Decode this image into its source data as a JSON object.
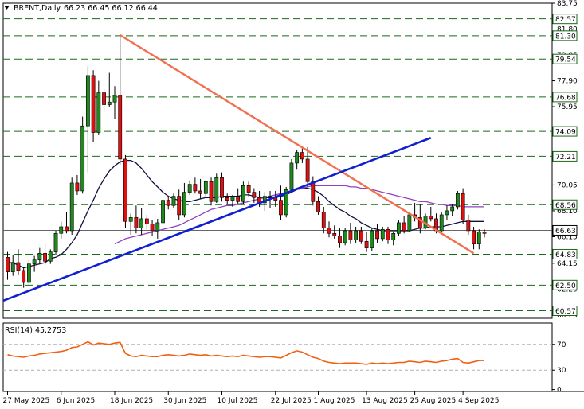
{
  "header": {
    "symbol": "BRENT,Daily",
    "ohlc": "66.23 66.45 66.12 66.44"
  },
  "rsi_header": "RSI(14) 45.2753",
  "colors": {
    "bull": "#1e8a1e",
    "bear": "#e01010",
    "resistance_line": "#f07050",
    "support_line": "#1020d0",
    "ma_fast": "#101040",
    "ma_slow": "#9040c0",
    "rsi_line": "#f06010",
    "level_line": "#1a6a1a",
    "current_price_line": "#505050"
  },
  "chart_data": [
    {
      "type": "candlestick",
      "title": "BRENT,Daily",
      "ylim": [
        60.0,
        83.75
      ],
      "y_ticks": [
        "83.75",
        "81.80",
        "79.85",
        "77.90",
        "75.95",
        "74.00",
        "72.05",
        "70.05",
        "68.10",
        "66.15",
        "64.15",
        "62.20",
        "60.25"
      ],
      "x_tick_labels": [
        "27 May 2025",
        "6 Jun 2025",
        "18 Jun 2025",
        "30 Jun 2025",
        "10 Jul 2025",
        "22 Jul 2025",
        "1 Aug 2025",
        "13 Aug 2025",
        "25 Aug 2025",
        "4 Sep 2025"
      ],
      "x_tick_index": [
        0,
        10,
        20,
        30,
        40,
        50,
        58,
        67,
        76,
        85
      ],
      "level_lines": [
        "82.57",
        "81.30",
        "79.54",
        "76.68",
        "74.09",
        "72.21",
        "68.56",
        "64.83",
        "62.50",
        "60.57"
      ],
      "current_price": "66.63",
      "candles": [
        {
          "o": 64.6,
          "h": 65.0,
          "l": 62.9,
          "c": 63.5
        },
        {
          "o": 63.5,
          "h": 64.8,
          "l": 63.2,
          "c": 64.2
        },
        {
          "o": 64.2,
          "h": 65.2,
          "l": 63.3,
          "c": 63.6
        },
        {
          "o": 63.6,
          "h": 63.9,
          "l": 62.3,
          "c": 62.7
        },
        {
          "o": 62.7,
          "h": 64.4,
          "l": 62.5,
          "c": 64.1
        },
        {
          "o": 64.1,
          "h": 64.7,
          "l": 63.5,
          "c": 64.4
        },
        {
          "o": 64.4,
          "h": 65.3,
          "l": 64.2,
          "c": 64.9
        },
        {
          "o": 64.9,
          "h": 65.6,
          "l": 64.0,
          "c": 64.3
        },
        {
          "o": 64.3,
          "h": 65.2,
          "l": 64.1,
          "c": 65.0
        },
        {
          "o": 65.0,
          "h": 66.6,
          "l": 64.8,
          "c": 66.4
        },
        {
          "o": 66.4,
          "h": 67.3,
          "l": 66.0,
          "c": 66.9
        },
        {
          "o": 66.9,
          "h": 68.0,
          "l": 66.4,
          "c": 66.6
        },
        {
          "o": 66.6,
          "h": 70.6,
          "l": 66.3,
          "c": 70.2
        },
        {
          "o": 70.2,
          "h": 70.8,
          "l": 69.3,
          "c": 69.6
        },
        {
          "o": 69.6,
          "h": 75.2,
          "l": 69.4,
          "c": 74.5
        },
        {
          "o": 74.5,
          "h": 79.0,
          "l": 71.0,
          "c": 78.3
        },
        {
          "o": 78.3,
          "h": 78.7,
          "l": 73.3,
          "c": 74.0
        },
        {
          "o": 74.0,
          "h": 77.9,
          "l": 73.8,
          "c": 77.0
        },
        {
          "o": 77.0,
          "h": 77.3,
          "l": 75.5,
          "c": 76.1
        },
        {
          "o": 76.1,
          "h": 78.5,
          "l": 75.9,
          "c": 76.3
        },
        {
          "o": 76.3,
          "h": 77.5,
          "l": 75.0,
          "c": 76.8
        },
        {
          "o": 76.8,
          "h": 81.4,
          "l": 71.6,
          "c": 72.0
        },
        {
          "o": 72.0,
          "h": 72.3,
          "l": 66.8,
          "c": 67.3
        },
        {
          "o": 67.3,
          "h": 67.9,
          "l": 66.3,
          "c": 67.6
        },
        {
          "o": 67.6,
          "h": 68.5,
          "l": 66.4,
          "c": 66.8
        },
        {
          "o": 66.8,
          "h": 68.3,
          "l": 66.3,
          "c": 67.5
        },
        {
          "o": 67.5,
          "h": 67.8,
          "l": 66.7,
          "c": 67.1
        },
        {
          "o": 67.1,
          "h": 67.4,
          "l": 66.2,
          "c": 66.6
        },
        {
          "o": 66.6,
          "h": 67.5,
          "l": 66.0,
          "c": 67.2
        },
        {
          "o": 67.2,
          "h": 69.0,
          "l": 67.0,
          "c": 68.9
        },
        {
          "o": 68.9,
          "h": 69.2,
          "l": 68.2,
          "c": 68.5
        },
        {
          "o": 68.5,
          "h": 69.4,
          "l": 68.3,
          "c": 69.2
        },
        {
          "o": 69.2,
          "h": 69.7,
          "l": 67.4,
          "c": 67.8
        },
        {
          "o": 67.8,
          "h": 70.2,
          "l": 67.6,
          "c": 69.5
        },
        {
          "o": 69.5,
          "h": 70.4,
          "l": 69.3,
          "c": 70.1
        },
        {
          "o": 70.1,
          "h": 70.6,
          "l": 69.4,
          "c": 69.6
        },
        {
          "o": 69.6,
          "h": 70.5,
          "l": 69.0,
          "c": 69.4
        },
        {
          "o": 69.4,
          "h": 70.4,
          "l": 69.2,
          "c": 70.3
        },
        {
          "o": 70.3,
          "h": 70.6,
          "l": 68.5,
          "c": 68.8
        },
        {
          "o": 68.8,
          "h": 70.9,
          "l": 68.7,
          "c": 70.6
        },
        {
          "o": 70.6,
          "h": 71.0,
          "l": 68.8,
          "c": 69.1
        },
        {
          "o": 69.1,
          "h": 69.4,
          "l": 68.6,
          "c": 68.9
        },
        {
          "o": 68.9,
          "h": 69.3,
          "l": 68.4,
          "c": 69.2
        },
        {
          "o": 69.2,
          "h": 69.8,
          "l": 68.6,
          "c": 68.8
        },
        {
          "o": 68.8,
          "h": 70.3,
          "l": 68.6,
          "c": 70.0
        },
        {
          "o": 70.0,
          "h": 70.3,
          "l": 69.2,
          "c": 69.5
        },
        {
          "o": 69.5,
          "h": 69.8,
          "l": 68.7,
          "c": 69.1
        },
        {
          "o": 69.1,
          "h": 69.6,
          "l": 68.4,
          "c": 68.7
        },
        {
          "o": 68.7,
          "h": 69.5,
          "l": 68.1,
          "c": 69.2
        },
        {
          "o": 69.2,
          "h": 69.6,
          "l": 68.3,
          "c": 69.1
        },
        {
          "o": 69.1,
          "h": 69.6,
          "l": 68.4,
          "c": 68.9
        },
        {
          "o": 68.9,
          "h": 70.0,
          "l": 67.4,
          "c": 67.8
        },
        {
          "o": 67.8,
          "h": 69.9,
          "l": 67.6,
          "c": 69.7
        },
        {
          "o": 69.7,
          "h": 72.0,
          "l": 69.5,
          "c": 71.7
        },
        {
          "o": 71.7,
          "h": 72.7,
          "l": 71.2,
          "c": 72.5
        },
        {
          "o": 72.5,
          "h": 72.8,
          "l": 71.7,
          "c": 72.0
        },
        {
          "o": 72.0,
          "h": 72.9,
          "l": 69.9,
          "c": 70.3
        },
        {
          "o": 70.3,
          "h": 70.7,
          "l": 68.5,
          "c": 68.8
        },
        {
          "o": 68.8,
          "h": 69.2,
          "l": 67.8,
          "c": 68.0
        },
        {
          "o": 68.0,
          "h": 68.4,
          "l": 66.4,
          "c": 66.8
        },
        {
          "o": 66.8,
          "h": 67.3,
          "l": 66.1,
          "c": 66.4
        },
        {
          "o": 66.4,
          "h": 67.0,
          "l": 66.0,
          "c": 66.2
        },
        {
          "o": 66.2,
          "h": 66.8,
          "l": 65.3,
          "c": 65.7
        },
        {
          "o": 65.7,
          "h": 66.8,
          "l": 65.5,
          "c": 66.6
        },
        {
          "o": 66.6,
          "h": 67.2,
          "l": 65.6,
          "c": 65.9
        },
        {
          "o": 65.9,
          "h": 66.9,
          "l": 65.7,
          "c": 66.6
        },
        {
          "o": 66.6,
          "h": 66.9,
          "l": 65.6,
          "c": 65.8
        },
        {
          "o": 65.8,
          "h": 66.5,
          "l": 65.0,
          "c": 65.3
        },
        {
          "o": 65.3,
          "h": 66.8,
          "l": 65.1,
          "c": 66.6
        },
        {
          "o": 66.6,
          "h": 67.1,
          "l": 65.7,
          "c": 66.0
        },
        {
          "o": 66.0,
          "h": 66.9,
          "l": 65.8,
          "c": 66.7
        },
        {
          "o": 66.7,
          "h": 66.9,
          "l": 65.6,
          "c": 65.9
        },
        {
          "o": 65.9,
          "h": 66.5,
          "l": 65.5,
          "c": 66.4
        },
        {
          "o": 66.4,
          "h": 67.4,
          "l": 66.2,
          "c": 67.2
        },
        {
          "o": 67.2,
          "h": 67.7,
          "l": 66.4,
          "c": 66.6
        },
        {
          "o": 66.6,
          "h": 67.9,
          "l": 66.5,
          "c": 67.8
        },
        {
          "o": 67.8,
          "h": 68.7,
          "l": 67.3,
          "c": 67.6
        },
        {
          "o": 67.6,
          "h": 68.6,
          "l": 66.4,
          "c": 66.8
        },
        {
          "o": 66.8,
          "h": 67.9,
          "l": 66.7,
          "c": 67.7
        },
        {
          "o": 67.7,
          "h": 68.4,
          "l": 67.3,
          "c": 67.5
        },
        {
          "o": 67.5,
          "h": 67.9,
          "l": 66.4,
          "c": 66.6
        },
        {
          "o": 66.6,
          "h": 68.0,
          "l": 66.5,
          "c": 67.8
        },
        {
          "o": 67.8,
          "h": 68.5,
          "l": 67.4,
          "c": 68.1
        },
        {
          "o": 68.1,
          "h": 68.6,
          "l": 67.7,
          "c": 68.4
        },
        {
          "o": 68.4,
          "h": 69.6,
          "l": 68.2,
          "c": 69.4
        },
        {
          "o": 69.4,
          "h": 69.8,
          "l": 67.1,
          "c": 67.4
        },
        {
          "o": 67.4,
          "h": 67.8,
          "l": 66.3,
          "c": 66.6
        },
        {
          "o": 66.6,
          "h": 66.9,
          "l": 65.2,
          "c": 65.6
        },
        {
          "o": 65.6,
          "h": 66.7,
          "l": 65.2,
          "c": 66.5
        },
        {
          "o": 66.5,
          "h": 66.7,
          "l": 66.1,
          "c": 66.4
        }
      ],
      "overlays": [
        {
          "kind": "ma_fast",
          "values": [
            64.2,
            64.2,
            64.0,
            63.8,
            63.9,
            64.0,
            64.1,
            64.2,
            64.5,
            64.6,
            64.8,
            65.2,
            65.7,
            66.3,
            67.2,
            68.1,
            68.9,
            69.8,
            70.5,
            71.1,
            71.5,
            71.8,
            71.9,
            71.9,
            71.7,
            71.3,
            70.8,
            70.3,
            69.9,
            69.5,
            69.2,
            69.0,
            68.9,
            68.8,
            68.8,
            68.9,
            69.0,
            69.1,
            69.1,
            69.1,
            69.2,
            69.2,
            69.2,
            69.2,
            69.3,
            69.3,
            69.2,
            69.1,
            69.1,
            69.1,
            69.1,
            69.2,
            69.3,
            69.5,
            69.7,
            69.8,
            69.8,
            69.7,
            69.5,
            69.2,
            68.8,
            68.5,
            68.2,
            68.0,
            67.7,
            67.5,
            67.2,
            67.0,
            66.8,
            66.7,
            66.6,
            66.6,
            66.6,
            66.6,
            66.6,
            66.6,
            66.7,
            66.8,
            66.8,
            66.9,
            66.9,
            66.9,
            67.0,
            67.1,
            67.2,
            67.3,
            67.3,
            67.3,
            67.3,
            67.3
          ]
        },
        {
          "kind": "ma_slow",
          "values": [
            null,
            null,
            null,
            null,
            null,
            null,
            null,
            null,
            null,
            null,
            null,
            null,
            null,
            null,
            null,
            null,
            null,
            null,
            null,
            null,
            65.6,
            65.8,
            66.0,
            66.1,
            66.2,
            66.3,
            66.4,
            66.5,
            66.6,
            66.7,
            66.8,
            66.9,
            67.0,
            67.2,
            67.4,
            67.6,
            67.8,
            68.0,
            68.2,
            68.3,
            68.4,
            68.5,
            68.5,
            68.6,
            68.7,
            68.8,
            68.9,
            69.0,
            69.1,
            69.2,
            69.3,
            69.4,
            69.5,
            69.6,
            69.7,
            69.8,
            69.9,
            70.0,
            70.0,
            70.0,
            70.0,
            70.0,
            70.0,
            70.0,
            69.9,
            69.9,
            69.8,
            69.8,
            69.7,
            69.6,
            69.5,
            69.4,
            69.3,
            69.2,
            69.1,
            69.0,
            68.9,
            68.8,
            68.8,
            68.7,
            68.6,
            68.6,
            68.5,
            68.5,
            68.5,
            68.4,
            68.4,
            68.4,
            68.4,
            68.4
          ]
        },
        {
          "kind": "trendline",
          "name": "resistance",
          "from": {
            "i": 21,
            "y": 81.35
          },
          "to": {
            "i": 87,
            "y": 64.9
          }
        },
        {
          "kind": "trendline",
          "name": "support",
          "from": {
            "i": -1,
            "y": 61.3
          },
          "to": {
            "i": 79,
            "y": 73.6
          }
        }
      ]
    },
    {
      "type": "line",
      "title": "RSI(14) 45.2753",
      "ylim": [
        -3,
        103
      ],
      "y_ticks": [
        "70",
        "30",
        "0"
      ],
      "reference_lines": [
        70,
        30
      ],
      "values": [
        54,
        52,
        51,
        50,
        52,
        53,
        55,
        56,
        57,
        58,
        59,
        61,
        65,
        66,
        70,
        74,
        69,
        72,
        71,
        70,
        72,
        73,
        56,
        52,
        51,
        53,
        52,
        51,
        51,
        53,
        54,
        53,
        52,
        53,
        55,
        54,
        53,
        54,
        52,
        53,
        52,
        51,
        52,
        51,
        53,
        52,
        51,
        50,
        51,
        51,
        50,
        49,
        53,
        57,
        60,
        58,
        54,
        50,
        48,
        44,
        42,
        41,
        40,
        41,
        41,
        41,
        40,
        39,
        41,
        40,
        41,
        40,
        41,
        42,
        42,
        44,
        43,
        42,
        44,
        43,
        42,
        44,
        45,
        47,
        48,
        42,
        41,
        43,
        45,
        45
      ]
    }
  ]
}
